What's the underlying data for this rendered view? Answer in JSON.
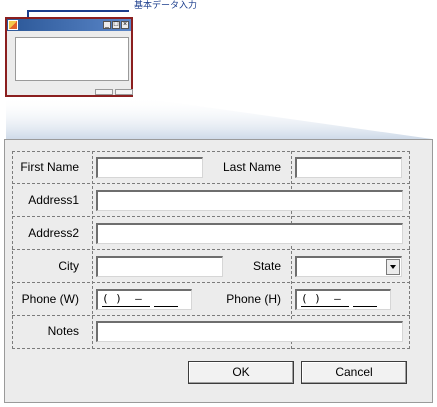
{
  "thumbnail": {
    "callout_label": "基本データ入力",
    "title_buttons": [
      "_",
      "□",
      "×"
    ]
  },
  "form": {
    "first_name_label": "First Name",
    "last_name_label": "Last Name",
    "address1_label": "Address1",
    "address2_label": "Address2",
    "city_label": "City",
    "state_label": "State",
    "phone_w_label": "Phone (W)",
    "phone_h_label": "Phone (H)",
    "phone_mask": "( )  –",
    "notes_label": "Notes"
  },
  "buttons": {
    "ok_label": "OK",
    "cancel_label": "Cancel"
  },
  "colors": {
    "thumbnail_border": "#8b1f1f",
    "callout": "#1a3c8c",
    "title_bar": "#2b5797",
    "dialog_bg": "#ececec"
  }
}
